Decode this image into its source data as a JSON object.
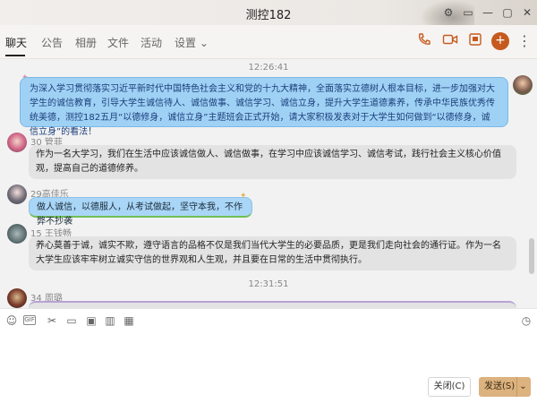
{
  "window": {
    "title": "测控182",
    "controls": [
      "⚙",
      "▭",
      "—",
      "▢",
      "✕"
    ]
  },
  "tabs": [
    {
      "label": "聊天"
    },
    {
      "label": "公告"
    },
    {
      "label": "相册"
    },
    {
      "label": "文件"
    },
    {
      "label": "活动"
    },
    {
      "label": "设置 ⌄"
    }
  ],
  "header_icons": [
    "phone-icon",
    "video-icon",
    "screenshare-icon",
    "add-icon",
    "more-icon"
  ],
  "chat": {
    "messages": [
      {
        "time": "12:26:41"
      },
      {
        "text": "为深入学习贯彻落实习近平新时代中国特色社会主义和党的十九大精神，全面落实立德树人根本目标，进一步加强对大学生的诚信教育，引导大学生诚信待人、诚信做事、诚信学习、诚信立身，提升大学生道德素养，传承中华民族优秀传统美德，测控182五月“以德修身，诚信立身”主题班会正式开始，请大家积极发表对于大学生如何做到“以德修身，诚信立身”的看法！"
      },
      {
        "name": "30 管菲",
        "text": "作为一名大学习，我们在生活中应该诚信做人、诚信做事，在学习中应该诚信学习、诚信考试，践行社会主义核心价值观，提高自己的道德修养。"
      },
      {
        "name": "29高佳乐",
        "text": "做人诚信，以德服人，从考试做起，坚守本我，不作弊不抄袭"
      },
      {
        "name": "15 王钱畅",
        "text": "养心莫善于诚，诚实不欺，遵守语言的品格不仅是我们当代大学生的必要品质，更是我们走向社会的通行证。作为一名大学生应该牢牢树立诚实守信的世界观和人生观，并且要在日常的生活中贯彻执行。"
      },
      {
        "time": "12:31:51"
      },
      {
        "name": "34 周璐"
      }
    ]
  },
  "toolbar": [
    "emoji-icon",
    "gif-icon",
    "scissors-icon",
    "folder-icon",
    "image-icon",
    "voice-icon",
    "more-tools-icon",
    "history-icon"
  ],
  "input": {
    "value": ""
  },
  "buttons": {
    "close": "关闭(C)",
    "send": "发送(S)",
    "send_arrow": "⌄"
  },
  "colors": {
    "accent": "#c65a1e",
    "send_button": "#dcb27f",
    "bubble_blue": "#a9d6f6"
  }
}
